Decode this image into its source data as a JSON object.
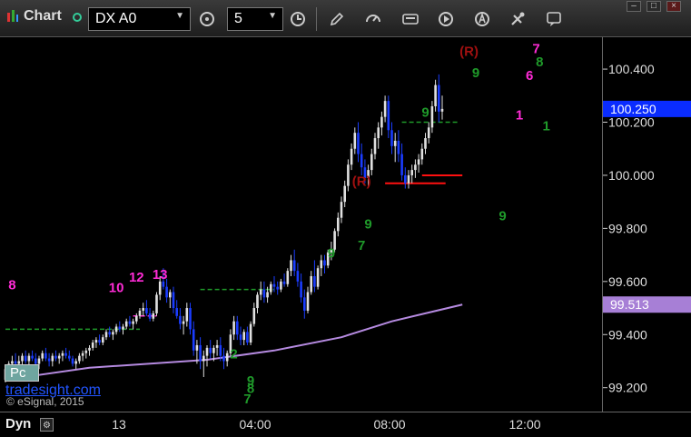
{
  "window": {
    "title": "Chart",
    "symbol": "DX A0",
    "interval": "5"
  },
  "footer": {
    "mode": "Dyn",
    "pc_button": "Pc",
    "site": "tradesight.com",
    "copyright": "© eSignal, 2015"
  },
  "colors": {
    "up": "#e0e0e0",
    "down": "#1a3cff",
    "signal_pink": "#ff2bd6",
    "signal_green": "#1f9a2a",
    "resistance": "#a01010",
    "moving_average": "#b58ae0",
    "level_red": "#ff1010",
    "level_green": "#1f9a2a"
  },
  "chart_data": {
    "type": "candlestick",
    "x_ticks": [
      "13",
      "04:00",
      "08:00",
      "12:00"
    ],
    "y_ticks": [
      "99.200",
      "99.400",
      "99.600",
      "99.800",
      "100.000",
      "100.200",
      "100.400"
    ],
    "ylim": [
      99.11,
      100.52
    ],
    "price_labels": [
      {
        "text": "100.250",
        "value": 100.25,
        "color": "#0a2cff"
      },
      {
        "text": "99.513",
        "value": 99.513,
        "color": "#a77fd6"
      }
    ],
    "candles": [
      [
        99.23,
        99.28,
        99.22,
        99.27
      ],
      [
        99.27,
        99.3,
        99.25,
        99.29
      ],
      [
        99.29,
        99.32,
        99.27,
        99.3
      ],
      [
        99.3,
        99.33,
        99.27,
        99.29
      ],
      [
        99.29,
        99.32,
        99.26,
        99.3
      ],
      [
        99.3,
        99.33,
        99.28,
        99.32
      ],
      [
        99.32,
        99.34,
        99.29,
        99.3
      ],
      [
        99.3,
        99.33,
        99.28,
        99.32
      ],
      [
        99.32,
        99.34,
        99.3,
        99.31
      ],
      [
        99.31,
        99.33,
        99.28,
        99.29
      ],
      [
        99.29,
        99.32,
        99.27,
        99.31
      ],
      [
        99.31,
        99.34,
        99.3,
        99.33
      ],
      [
        99.33,
        99.35,
        99.3,
        99.31
      ],
      [
        99.31,
        99.33,
        99.28,
        99.3
      ],
      [
        99.3,
        99.33,
        99.28,
        99.32
      ],
      [
        99.32,
        99.34,
        99.3,
        99.31
      ],
      [
        99.31,
        99.33,
        99.29,
        99.32
      ],
      [
        99.32,
        99.34,
        99.3,
        99.33
      ],
      [
        99.33,
        99.35,
        99.31,
        99.32
      ],
      [
        99.32,
        99.34,
        99.3,
        99.31
      ],
      [
        99.31,
        99.32,
        99.28,
        99.29
      ],
      [
        99.29,
        99.31,
        99.27,
        99.3
      ],
      [
        99.3,
        99.33,
        99.29,
        99.32
      ],
      [
        99.32,
        99.34,
        99.3,
        99.33
      ],
      [
        99.33,
        99.35,
        99.31,
        99.34
      ],
      [
        99.34,
        99.36,
        99.32,
        99.35
      ],
      [
        99.35,
        99.38,
        99.34,
        99.37
      ],
      [
        99.37,
        99.39,
        99.35,
        99.38
      ],
      [
        99.38,
        99.4,
        99.36,
        99.37
      ],
      [
        99.37,
        99.4,
        99.36,
        99.39
      ],
      [
        99.39,
        99.42,
        99.38,
        99.41
      ],
      [
        99.41,
        99.43,
        99.39,
        99.4
      ],
      [
        99.4,
        99.42,
        99.38,
        99.41
      ],
      [
        99.41,
        99.44,
        99.4,
        99.43
      ],
      [
        99.43,
        99.45,
        99.41,
        99.42
      ],
      [
        99.42,
        99.44,
        99.4,
        99.43
      ],
      [
        99.43,
        99.46,
        99.42,
        99.45
      ],
      [
        99.45,
        99.47,
        99.43,
        99.44
      ],
      [
        99.44,
        99.46,
        99.42,
        99.45
      ],
      [
        99.45,
        99.48,
        99.44,
        99.47
      ],
      [
        99.47,
        99.5,
        99.46,
        99.49
      ],
      [
        99.49,
        99.52,
        99.47,
        99.5
      ],
      [
        99.5,
        99.53,
        99.47,
        99.48
      ],
      [
        99.48,
        99.5,
        99.45,
        99.46
      ],
      [
        99.46,
        99.49,
        99.45,
        99.48
      ],
      [
        99.48,
        99.56,
        99.47,
        99.55
      ],
      [
        99.55,
        99.62,
        99.53,
        99.6
      ],
      [
        99.6,
        99.65,
        99.57,
        99.58
      ],
      [
        99.58,
        99.61,
        99.52,
        99.54
      ],
      [
        99.54,
        99.57,
        99.5,
        99.56
      ],
      [
        99.56,
        99.58,
        99.48,
        99.5
      ],
      [
        99.5,
        99.53,
        99.46,
        99.47
      ],
      [
        99.47,
        99.5,
        99.42,
        99.44
      ],
      [
        99.44,
        99.47,
        99.4,
        99.45
      ],
      [
        99.45,
        99.52,
        99.43,
        99.5
      ],
      [
        99.5,
        99.52,
        99.4,
        99.42
      ],
      [
        99.42,
        99.45,
        99.32,
        99.34
      ],
      [
        99.34,
        99.38,
        99.29,
        99.36
      ],
      [
        99.36,
        99.39,
        99.27,
        99.3
      ],
      [
        99.3,
        99.34,
        99.24,
        99.32
      ],
      [
        99.32,
        99.36,
        99.28,
        99.35
      ],
      [
        99.35,
        99.38,
        99.31,
        99.33
      ],
      [
        99.33,
        99.36,
        99.3,
        99.35
      ],
      [
        99.35,
        99.38,
        99.32,
        99.36
      ],
      [
        99.36,
        99.39,
        99.3,
        99.32
      ],
      [
        99.32,
        99.35,
        99.27,
        99.3
      ],
      [
        99.3,
        99.34,
        99.28,
        99.33
      ],
      [
        99.33,
        99.42,
        99.32,
        99.4
      ],
      [
        99.4,
        99.47,
        99.38,
        99.45
      ],
      [
        99.45,
        99.47,
        99.38,
        99.4
      ],
      [
        99.4,
        99.43,
        99.36,
        99.38
      ],
      [
        99.38,
        99.42,
        99.36,
        99.41
      ],
      [
        99.41,
        99.43,
        99.36,
        99.37
      ],
      [
        99.37,
        99.45,
        99.36,
        99.44
      ],
      [
        99.44,
        99.52,
        99.43,
        99.5
      ],
      [
        99.5,
        99.56,
        99.48,
        99.55
      ],
      [
        99.55,
        99.6,
        99.53,
        99.57
      ],
      [
        99.57,
        99.6,
        99.52,
        99.54
      ],
      [
        99.54,
        99.58,
        99.52,
        99.56
      ],
      [
        99.56,
        99.6,
        99.55,
        99.59
      ],
      [
        99.59,
        99.62,
        99.56,
        99.58
      ],
      [
        99.58,
        99.6,
        99.55,
        99.57
      ],
      [
        99.57,
        99.61,
        99.56,
        99.6
      ],
      [
        99.6,
        99.63,
        99.58,
        99.59
      ],
      [
        99.59,
        99.65,
        99.58,
        99.64
      ],
      [
        99.64,
        99.7,
        99.62,
        99.68
      ],
      [
        99.68,
        99.72,
        99.62,
        99.64
      ],
      [
        99.64,
        99.67,
        99.58,
        99.6
      ],
      [
        99.6,
        99.63,
        99.52,
        99.54
      ],
      [
        99.54,
        99.57,
        99.46,
        99.49
      ],
      [
        99.49,
        99.58,
        99.48,
        99.56
      ],
      [
        99.56,
        99.64,
        99.55,
        99.62
      ],
      [
        99.62,
        99.68,
        99.56,
        99.58
      ],
      [
        99.58,
        99.66,
        99.57,
        99.65
      ],
      [
        99.65,
        99.7,
        99.62,
        99.68
      ],
      [
        99.68,
        99.7,
        99.63,
        99.66
      ],
      [
        99.66,
        99.72,
        99.65,
        99.71
      ],
      [
        99.71,
        99.75,
        99.68,
        99.72
      ],
      [
        99.72,
        99.8,
        99.71,
        99.79
      ],
      [
        99.79,
        99.86,
        99.77,
        99.84
      ],
      [
        99.84,
        99.92,
        99.82,
        99.9
      ],
      [
        99.9,
        99.98,
        99.88,
        99.96
      ],
      [
        99.96,
        100.06,
        99.94,
        100.04
      ],
      [
        100.04,
        100.12,
        100.02,
        100.1
      ],
      [
        100.1,
        100.18,
        100.08,
        100.16
      ],
      [
        100.16,
        100.2,
        100.05,
        100.08
      ],
      [
        100.08,
        100.12,
        100.0,
        100.03
      ],
      [
        100.03,
        100.06,
        99.97,
        99.99
      ],
      [
        99.99,
        100.04,
        99.96,
        100.02
      ],
      [
        100.02,
        100.1,
        100.0,
        100.08
      ],
      [
        100.08,
        100.16,
        100.06,
        100.14
      ],
      [
        100.14,
        100.2,
        100.1,
        100.18
      ],
      [
        100.18,
        100.24,
        100.15,
        100.22
      ],
      [
        100.22,
        100.3,
        100.2,
        100.28
      ],
      [
        100.28,
        100.3,
        100.14,
        100.17
      ],
      [
        100.17,
        100.2,
        100.08,
        100.11
      ],
      [
        100.11,
        100.16,
        100.05,
        100.13
      ],
      [
        100.13,
        100.17,
        100.05,
        100.08
      ],
      [
        100.08,
        100.12,
        99.98,
        100.0
      ],
      [
        100.0,
        100.03,
        99.95,
        99.97
      ],
      [
        99.97,
        100.02,
        99.95,
        100.0
      ],
      [
        100.0,
        100.04,
        99.97,
        100.02
      ],
      [
        100.02,
        100.06,
        99.99,
        100.04
      ],
      [
        100.04,
        100.08,
        100.01,
        100.06
      ],
      [
        100.06,
        100.12,
        100.04,
        100.1
      ],
      [
        100.1,
        100.16,
        100.08,
        100.14
      ],
      [
        100.14,
        100.2,
        100.12,
        100.18
      ],
      [
        100.18,
        100.28,
        100.16,
        100.26
      ],
      [
        100.26,
        100.36,
        100.24,
        100.34
      ],
      [
        100.34,
        100.38,
        100.2,
        100.24
      ],
      [
        100.24,
        100.3,
        100.21,
        100.25
      ]
    ],
    "moving_average": [
      [
        0,
        99.23
      ],
      [
        25,
        99.275
      ],
      [
        60,
        99.305
      ],
      [
        80,
        99.34
      ],
      [
        100,
        99.39
      ],
      [
        115,
        99.45
      ],
      [
        125,
        99.48
      ],
      [
        136,
        99.513
      ]
    ],
    "levels": [
      {
        "value": 99.42,
        "from": 0,
        "to": 40,
        "style": "dash",
        "color": "green"
      },
      {
        "value": 99.47,
        "from": 38,
        "to": 45,
        "style": "dash",
        "color": "pink"
      },
      {
        "value": 99.57,
        "from": 58,
        "to": 80,
        "style": "dash",
        "color": "green"
      },
      {
        "value": 100.2,
        "from": 118,
        "to": 135,
        "style": "dash",
        "color": "green"
      },
      {
        "value": 100.0,
        "from": 124,
        "to": 136,
        "style": "solid",
        "color": "red"
      },
      {
        "value": 99.97,
        "from": 113,
        "to": 131,
        "style": "solid",
        "color": "red"
      }
    ],
    "annotations": [
      {
        "text": "8",
        "i": 2,
        "v": 99.57,
        "color": "pink"
      },
      {
        "text": "10",
        "i": 33,
        "v": 99.56,
        "color": "pink"
      },
      {
        "text": "12",
        "i": 39,
        "v": 99.6,
        "color": "pink"
      },
      {
        "text": "13",
        "i": 46,
        "v": 99.61,
        "color": "pink"
      },
      {
        "text": "(R)",
        "i": 106,
        "v": 99.96,
        "color": "dark-red"
      },
      {
        "text": "(R)",
        "i": 138,
        "v": 100.45,
        "color": "dark-red"
      },
      {
        "text": "9",
        "i": 108,
        "v": 99.8,
        "color": "green"
      },
      {
        "text": "7",
        "i": 106,
        "v": 99.72,
        "color": "green"
      },
      {
        "text": "9",
        "i": 97,
        "v": 99.69,
        "color": "green"
      },
      {
        "text": "9",
        "i": 125,
        "v": 100.22,
        "color": "green"
      },
      {
        "text": "9",
        "i": 140,
        "v": 100.37,
        "color": "green"
      },
      {
        "text": "8",
        "i": 159,
        "v": 100.41,
        "color": "green"
      },
      {
        "text": "9",
        "i": 148,
        "v": 99.83,
        "color": "green"
      },
      {
        "text": "7",
        "i": 158,
        "v": 100.46,
        "color": "pink"
      },
      {
        "text": "6",
        "i": 156,
        "v": 100.36,
        "color": "pink"
      },
      {
        "text": "1",
        "i": 153,
        "v": 100.21,
        "color": "pink"
      },
      {
        "text": "1",
        "i": 161,
        "v": 100.17,
        "color": "green"
      },
      {
        "text": "2",
        "i": 68,
        "v": 99.31,
        "color": "green"
      },
      {
        "text": "9",
        "i": 73,
        "v": 99.21,
        "color": "green"
      },
      {
        "text": "8",
        "i": 73,
        "v": 99.18,
        "color": "green"
      },
      {
        "text": "7",
        "i": 72,
        "v": 99.14,
        "color": "green"
      }
    ]
  }
}
